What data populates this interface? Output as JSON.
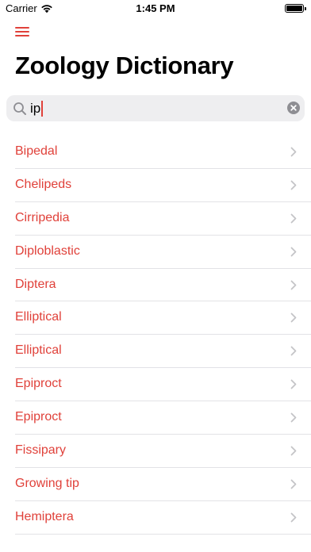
{
  "status_bar": {
    "carrier": "Carrier",
    "time": "1:45 PM",
    "battery_level": 1.0
  },
  "header": {
    "title": "Zoology Dictionary"
  },
  "search": {
    "value": "ip",
    "placeholder": ""
  },
  "terms": [
    {
      "label": "Bipedal"
    },
    {
      "label": "Chelipeds"
    },
    {
      "label": "Cirripedia"
    },
    {
      "label": "Diploblastic"
    },
    {
      "label": "Diptera"
    },
    {
      "label": "Elliptical"
    },
    {
      "label": "Elliptical"
    },
    {
      "label": "Epiproct"
    },
    {
      "label": "Epiproct"
    },
    {
      "label": "Fissipary"
    },
    {
      "label": "Growing tip"
    },
    {
      "label": "Hemiptera"
    }
  ],
  "colors": {
    "accent": "#e0413a",
    "separator": "#e2e2e6",
    "search_background": "#eeeef0",
    "chevron": "#c4c4c7"
  },
  "icons": {
    "menu": "hamburger-menu-icon",
    "search": "search-icon",
    "clear": "clear-icon",
    "row": "chevron-right-icon",
    "wifi": "wifi-icon",
    "battery": "battery-icon"
  }
}
